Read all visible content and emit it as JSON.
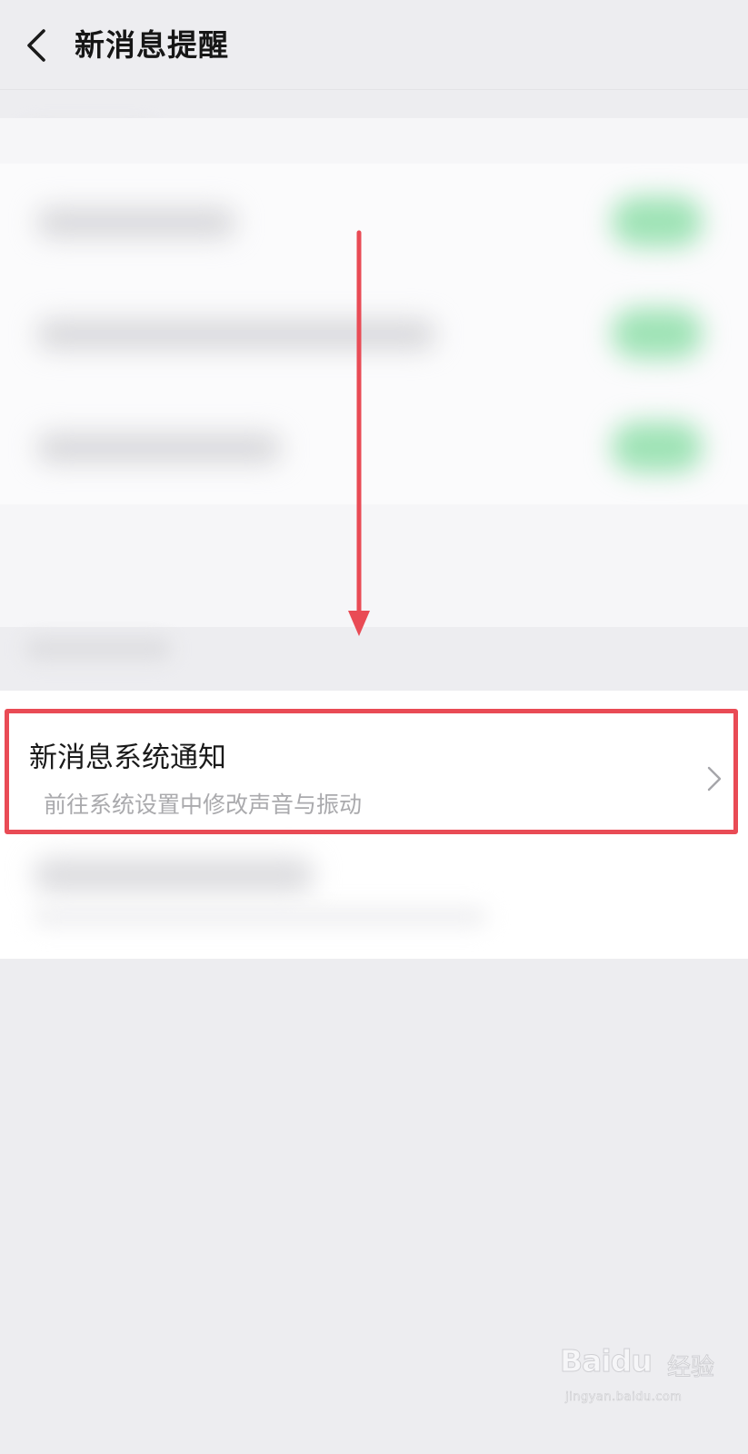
{
  "nav": {
    "title": "新消息提醒",
    "back_icon": "chevron-left-icon"
  },
  "notification_item": {
    "title": "新消息系统通知",
    "subtitle": "前往系统设置中修改声音与振动",
    "chevron_icon": "chevron-right-icon"
  },
  "annotations": {
    "highlight_color": "#e94b55",
    "arrow_color": "#e94b55"
  },
  "watermark": {
    "logo": "Baidu",
    "label": "经验",
    "url": "jingyan.baidu.com"
  },
  "colors": {
    "background": "#ededf0",
    "card": "#ffffff",
    "toggle_on_blurred": "#9fe3b6"
  }
}
